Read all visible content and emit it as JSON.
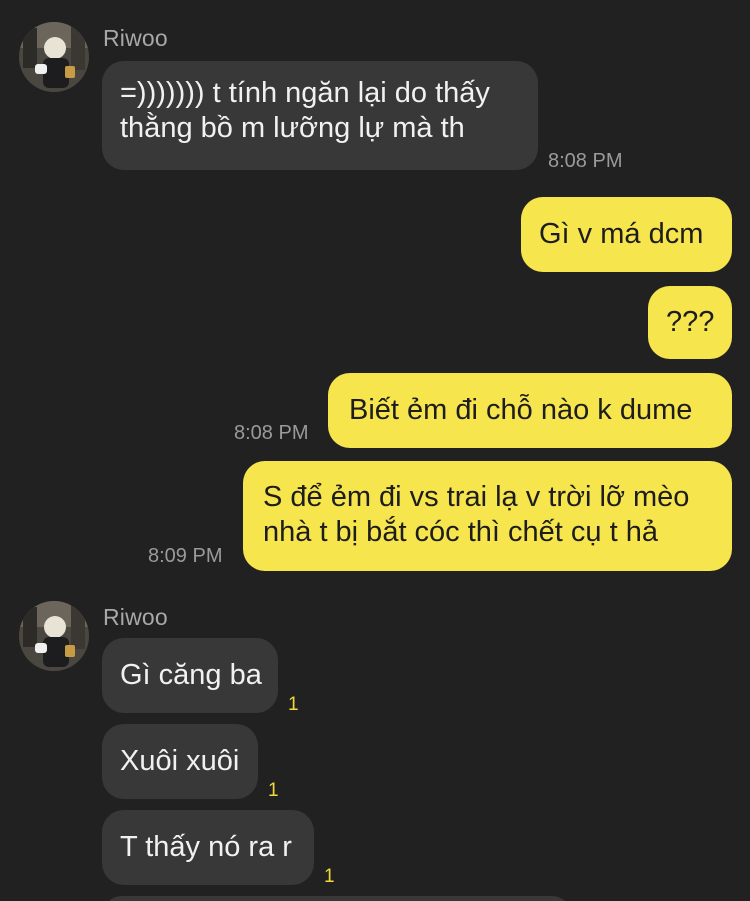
{
  "groups": [
    {
      "sender": "Riwoo",
      "messages": [
        {
          "direction": "in",
          "lines": [
            "=))))))) t tính ngăn lại do thấy",
            "thằng bồ m lưỡng lự mà th"
          ],
          "time": "8:08 PM"
        }
      ]
    }
  ],
  "outgoing": [
    {
      "text": "Gì v má dcm"
    },
    {
      "text": "???"
    },
    {
      "text": "Biết ẻm đi chỗ nào k dume",
      "time": "8:08 PM"
    },
    {
      "lines": [
        "S để ẻm đi vs trai lạ v trời lỡ mèo",
        "nhà t bị bắt cóc thì chết cụ t hả"
      ],
      "time": "8:09 PM"
    }
  ],
  "second_group": {
    "sender": "Riwoo",
    "messages": [
      {
        "text": "Gì căng ba",
        "unread": "1"
      },
      {
        "text": "Xuôi xuôi",
        "unread": "1"
      },
      {
        "text": "T thấy nó ra r",
        "unread": "1"
      }
    ]
  },
  "colors": {
    "background": "#212121",
    "incoming_bubble": "#383838",
    "outgoing_bubble": "#f7e54e",
    "unread_badge": "#f2d93b"
  }
}
